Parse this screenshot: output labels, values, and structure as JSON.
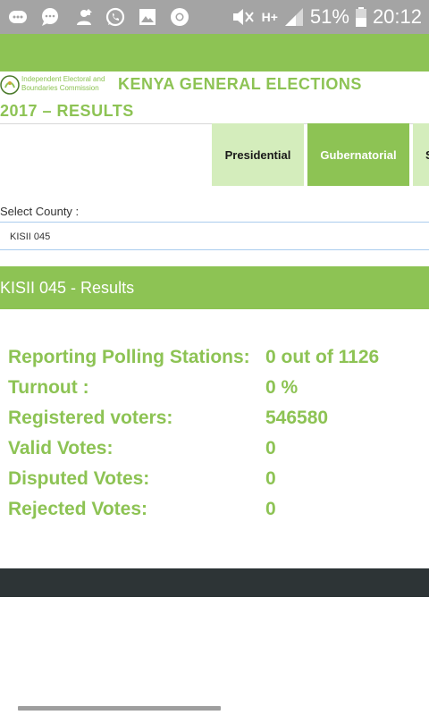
{
  "status_bar": {
    "battery": "51%",
    "time": "20:12",
    "network": "H+",
    "icons": [
      "keyboard-icon",
      "chat-bubble-icon",
      "person-upload-icon",
      "whatsapp-icon",
      "image-icon",
      "chrome-icon",
      "mute-icon",
      "network-icon",
      "signal-icon",
      "battery-icon"
    ]
  },
  "header": {
    "org_line1": "Independent Electoral and",
    "org_line2": "Boundaries Commission",
    "title_line1": "KENYA GENERAL ELECTIONS",
    "title_line2": "2017 – RESULTS"
  },
  "tabs": [
    {
      "label": "Presidential"
    },
    {
      "label": "Gubernatorial"
    },
    {
      "label": "S"
    }
  ],
  "county_select": {
    "label": "Select County :",
    "value": "KISII 045"
  },
  "results": {
    "heading": "KISII 045 - Results",
    "rows": [
      {
        "label": "Reporting Polling Stations:",
        "value": "0 out of 1126"
      },
      {
        "label": "Turnout :",
        "value": "0 %"
      },
      {
        "label": "Registered voters:",
        "value": "546580"
      },
      {
        "label": "Valid Votes:",
        "value": "0"
      },
      {
        "label": "Disputed Votes:",
        "value": "0"
      },
      {
        "label": "Rejected Votes:",
        "value": "0"
      }
    ]
  },
  "colors": {
    "brand_green": "#8dc354",
    "light_green": "#d4edbc",
    "status_gray": "#a4a4a4",
    "footer_dark": "#2d3436"
  }
}
